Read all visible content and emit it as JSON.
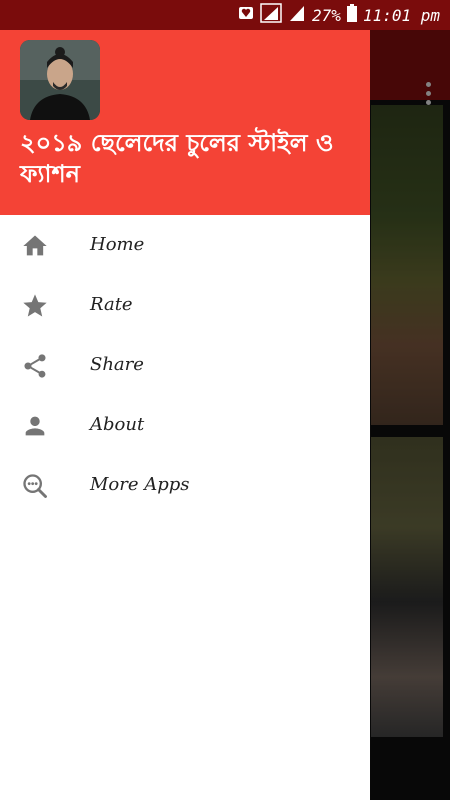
{
  "status_bar": {
    "battery": "27%",
    "time": "11:01 pm",
    "icons": [
      "notification-icon",
      "signal-icon",
      "signal-icon",
      "battery-icon"
    ]
  },
  "drawer": {
    "header_title": "২০১৯ ছেলেদের চুলের স্টাইল ও ফ্যাশন",
    "accent_color": "#f44336",
    "items": [
      {
        "label": "Home",
        "icon": "home-icon"
      },
      {
        "label": "Rate",
        "icon": "star-icon"
      },
      {
        "label": "Share",
        "icon": "share-icon"
      },
      {
        "label": "About",
        "icon": "person-icon"
      },
      {
        "label": "More Apps",
        "icon": "search-more-icon"
      }
    ]
  },
  "background_app": {
    "toolbar_color": "#6e0c0c",
    "overflow_icon": "more-vert-icon"
  }
}
